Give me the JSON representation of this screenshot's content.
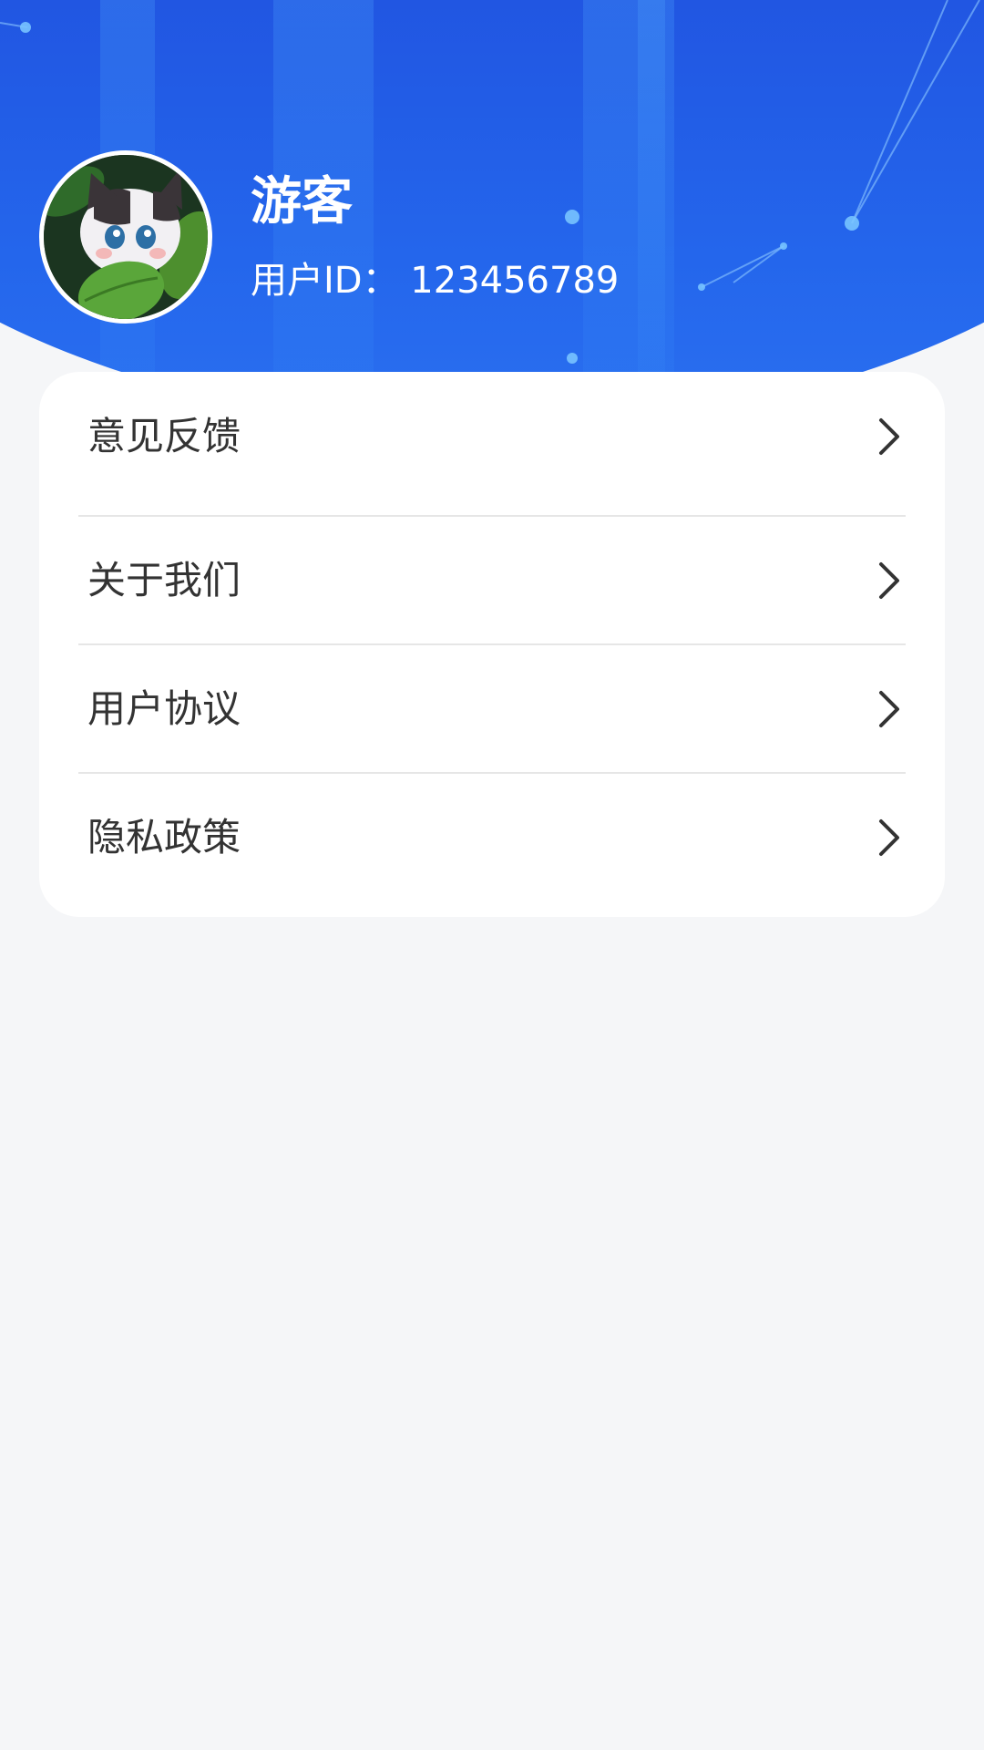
{
  "profile": {
    "name": "游客",
    "user_id": "用户ID： 123456789"
  },
  "menu": {
    "items": [
      {
        "label": "意见反馈",
        "icon": "chevron-right-icon"
      },
      {
        "label": "关于我们",
        "icon": "chevron-right-icon"
      },
      {
        "label": "用户协议",
        "icon": "chevron-right-icon"
      },
      {
        "label": "隐私政策",
        "icon": "chevron-right-icon"
      }
    ]
  },
  "colors": {
    "header_blue": "#2259e5",
    "background": "#f5f6f8",
    "card": "#ffffff",
    "text": "#333333",
    "divider": "#e6e6e6"
  }
}
